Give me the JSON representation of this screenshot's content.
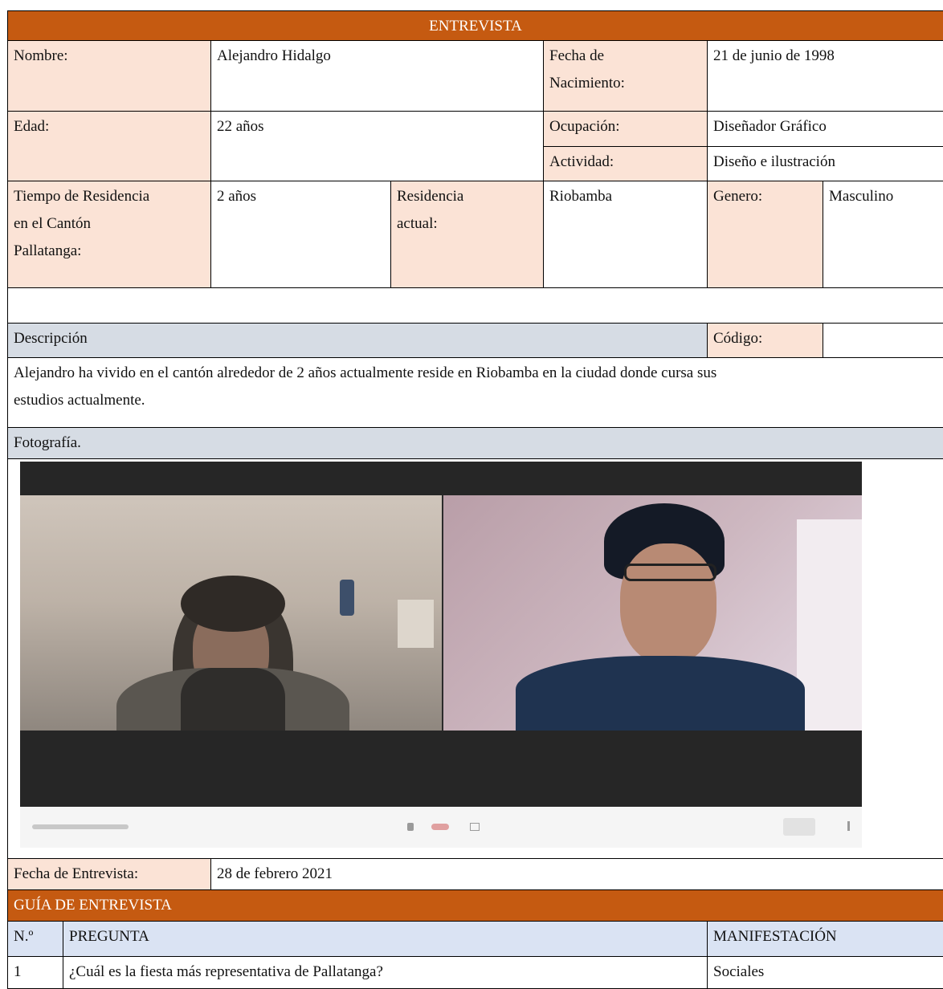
{
  "header": {
    "title": "ENTREVISTA"
  },
  "fields": {
    "nombre_label": "Nombre:",
    "nombre_value": "Alejandro Hidalgo",
    "fecha_nac_label_1": "Fecha de",
    "fecha_nac_label_2": "Nacimiento:",
    "fecha_nac_value": "21 de junio de 1998",
    "edad_label": "Edad:",
    "edad_value": "22 años",
    "ocupacion_label": "Ocupación:",
    "ocupacion_value": "Diseñador Gráfico",
    "actividad_label": "Actividad:",
    "actividad_value": "Diseño e ilustración",
    "tiempo_label_1": "Tiempo de Residencia",
    "tiempo_label_2": "en el Cantón",
    "tiempo_label_3": "Pallatanga:",
    "tiempo_value": "2 años",
    "residencia_label_1": "Residencia",
    "residencia_label_2": "actual:",
    "residencia_value": "Riobamba",
    "genero_label": "Genero:",
    "genero_value": "Masculino"
  },
  "description": {
    "label": "Descripción",
    "codigo_label": "Código:",
    "text_line_1": "Alejandro ha vivido en el cantón alrededor de 2 años actualmente reside en Riobamba en la ciudad donde cursa sus",
    "text_line_2": "estudios actualmente."
  },
  "photo": {
    "label": "Fotografía."
  },
  "interview_date": {
    "label": "Fecha de Entrevista:",
    "value": "28 de febrero 2021"
  },
  "guide": {
    "title": "GUÍA DE ENTREVISTA",
    "col_num": "N.º",
    "col_question": "PREGUNTA",
    "col_manifest": "MANIFESTACIÓN",
    "rows": [
      {
        "num": "1",
        "question": "¿Cuál es la fiesta más representativa de Pallatanga?",
        "manifest": "Sociales"
      }
    ]
  },
  "colors": {
    "accent": "#c55a11",
    "label_bg": "#fbe3d6",
    "section_bg": "#d6dce4",
    "header_row_bg": "#dae3f3"
  }
}
